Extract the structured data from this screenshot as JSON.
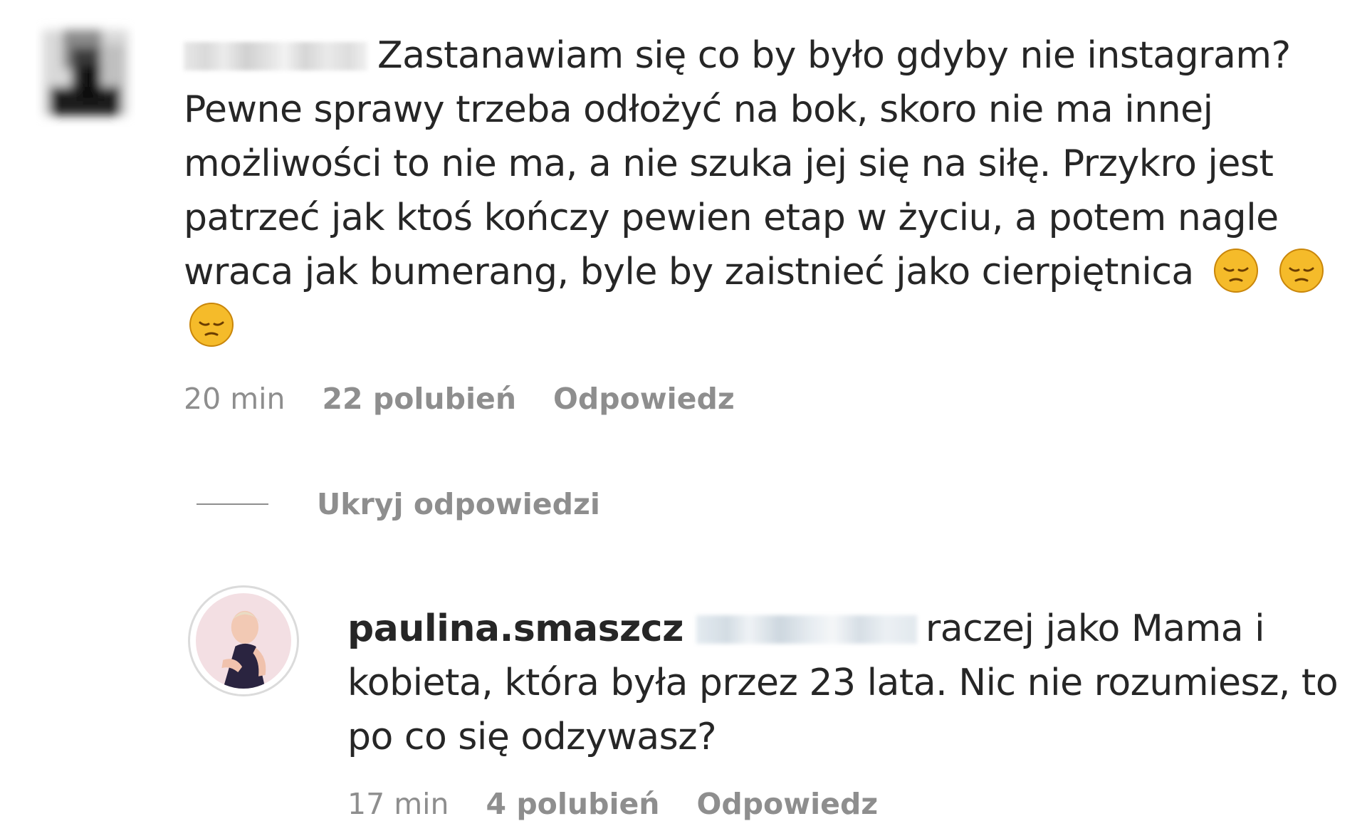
{
  "comment": {
    "text": "Zastanawiam się co by było gdyby nie instagram? Pewne sprawy trzeba odłożyć na bok, skoro nie ma innej możliwości to nie ma, a nie szuka jej się na siłę. Przykro jest patrzeć jak ktoś kończy pewien etap w życiu, a potem nagle wraca jak bumerang, byle by zaistnieć jako cierpiętnica",
    "emojis": [
      "pensive-face",
      "pensive-face",
      "pensive-face"
    ],
    "time": "20 min",
    "likes": "22 polubień",
    "reply_label": "Odpowiedz"
  },
  "replies_toggle": {
    "label": "Ukryj odpowiedzi"
  },
  "reply": {
    "username": "paulina.smaszcz",
    "text": "raczej jako Mama i kobieta, która była przez 23 lata. Nic nie rozumiesz, to po co się odzywasz?",
    "time": "17 min",
    "likes": "4 polubień",
    "reply_label": "Odpowiedz"
  },
  "colors": {
    "text": "#262626",
    "secondary": "#8e8e8e",
    "avatar_ring": "#dbdbdb",
    "emoji_face": "#f5bb2a"
  }
}
